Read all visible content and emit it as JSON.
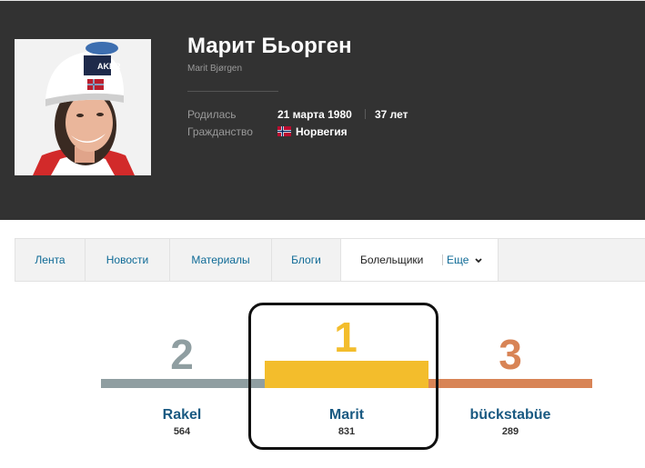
{
  "athlete": {
    "name": "Марит Бьорген",
    "latin_name": "Marit Bjørgen",
    "born_label": "Родилась",
    "born_value": "21 марта 1980",
    "age": "37 лет",
    "citizenship_label": "Гражданство",
    "citizenship_value": "Норвегия",
    "photo_caption_text": "AKER"
  },
  "tabs": [
    {
      "label": "Лента"
    },
    {
      "label": "Новости"
    },
    {
      "label": "Материалы"
    },
    {
      "label": "Блоги"
    },
    {
      "label": "Болельщики",
      "active": true
    }
  ],
  "more_label": "Еще",
  "podium": [
    {
      "place": "2",
      "name": "Rakel",
      "score": "564",
      "color": "#8f9ea1"
    },
    {
      "place": "1",
      "name": "Marit",
      "score": "831",
      "color": "#f3bd2c"
    },
    {
      "place": "3",
      "name": "bückstabüe",
      "score": "289",
      "color": "#d88456"
    }
  ],
  "colors": {
    "header_bg": "#323232",
    "link": "#0e6a96",
    "podium_name": "#1a5a82"
  }
}
